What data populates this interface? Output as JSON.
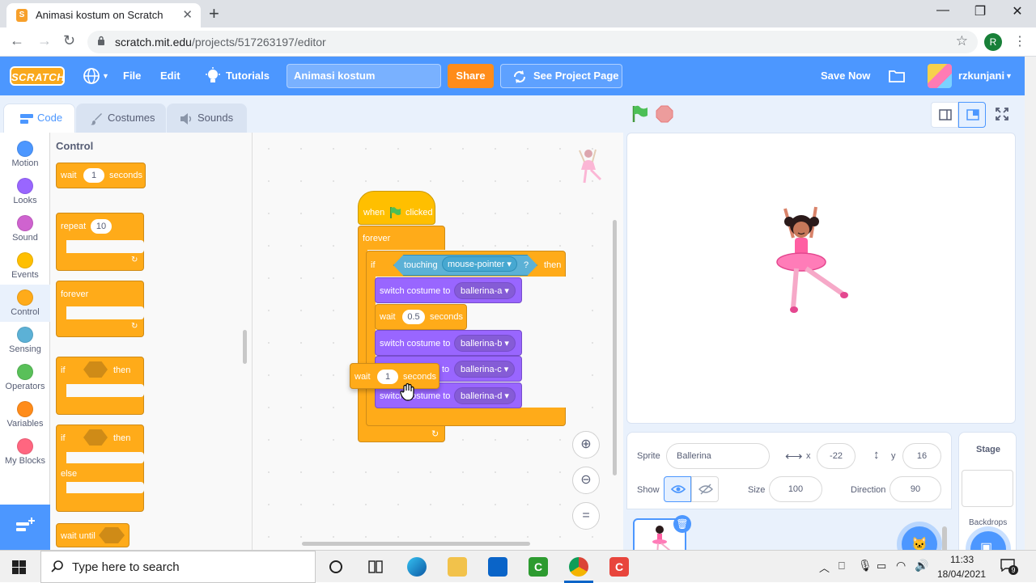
{
  "browser": {
    "tab_title": "Animasi kostum on Scratch",
    "url_host": "scratch.mit.edu",
    "url_path": "/projects/517263197/editor",
    "profile_initial": "R"
  },
  "menu": {
    "logo": "SCRATCH",
    "file": "File",
    "edit": "Edit",
    "tutorials": "Tutorials",
    "project_title": "Animasi kostum",
    "share": "Share",
    "see_project": "See Project Page",
    "save_now": "Save Now",
    "username": "rzkunjani"
  },
  "editor_tabs": {
    "code": "Code",
    "costumes": "Costumes",
    "sounds": "Sounds"
  },
  "categories": [
    {
      "label": "Motion",
      "color": "#4c97ff"
    },
    {
      "label": "Looks",
      "color": "#9966ff"
    },
    {
      "label": "Sound",
      "color": "#cf63cf"
    },
    {
      "label": "Events",
      "color": "#ffbf00"
    },
    {
      "label": "Control",
      "color": "#ffab19"
    },
    {
      "label": "Sensing",
      "color": "#5cb1d6"
    },
    {
      "label": "Operators",
      "color": "#59c059"
    },
    {
      "label": "Variables",
      "color": "#ff8c1a"
    },
    {
      "label": "My Blocks",
      "color": "#ff6680"
    }
  ],
  "palette": {
    "header": "Control",
    "wait": "wait",
    "wait_val": "1",
    "seconds": "seconds",
    "repeat": "repeat",
    "repeat_val": "10",
    "forever": "forever",
    "if": "if",
    "then": "then",
    "if2": "if",
    "then2": "then",
    "else": "else",
    "wait_until": "wait until"
  },
  "script": {
    "when": "when",
    "clicked": "clicked",
    "forever": "forever",
    "if": "if",
    "touching": "touching",
    "mouse_pointer": "mouse-pointer",
    "q": "?",
    "then": "then",
    "switch1": "switch costume to",
    "costume1": "ballerina-a",
    "wait1": "wait",
    "wait1_val": "0.5",
    "seconds1": "seconds",
    "switch2": "switch costume to",
    "costume2": "ballerina-b",
    "switch3_to": "to",
    "costume3": "ballerina-c",
    "switch4": "switch costume to",
    "costume4": "ballerina-d",
    "drag_wait": "wait",
    "drag_val": "1",
    "drag_seconds": "seconds"
  },
  "sprite_info": {
    "sprite_label": "Sprite",
    "sprite_name": "Ballerina",
    "x_label": "x",
    "x_val": "-22",
    "y_label": "y",
    "y_val": "16",
    "show_label": "Show",
    "size_label": "Size",
    "size_val": "100",
    "direction_label": "Direction",
    "direction_val": "90"
  },
  "stage_panel": {
    "title": "Stage",
    "backdrops": "Backdrops"
  },
  "taskbar": {
    "search_placeholder": "Type here to search",
    "time": "11:33",
    "date": "18/04/2021",
    "notif_count": "9"
  }
}
